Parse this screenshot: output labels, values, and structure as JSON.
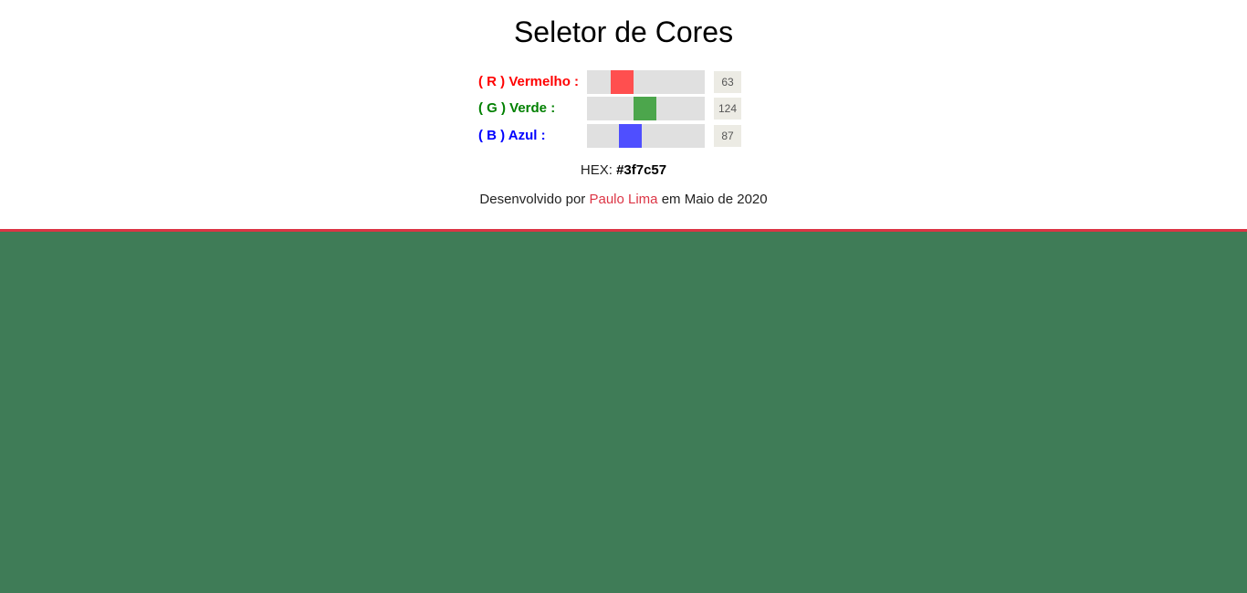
{
  "title": "Seletor de Cores",
  "channels": [
    {
      "label": "( R ) Vermelho :",
      "value": "63",
      "level": 0.247,
      "label_color": "#ff0000",
      "thumb_color": "#ff4f4f"
    },
    {
      "label": "( G ) Verde :",
      "value": "124",
      "level": 0.486,
      "label_color": "#008000",
      "thumb_color": "#4ca64c"
    },
    {
      "label": "( B ) Azul :",
      "value": "87",
      "level": 0.341,
      "label_color": "#0000ff",
      "thumb_color": "#4f4fff"
    }
  ],
  "hex": {
    "label": "HEX:",
    "value": "#3f7c57"
  },
  "credit": {
    "prefix": "Desenvolvido por",
    "author": "Paulo Lima",
    "suffix": "em Maio de 2020",
    "author_color": "#dc3545"
  },
  "divider_color": "#dc3545",
  "preview_color": "#3f7c57"
}
